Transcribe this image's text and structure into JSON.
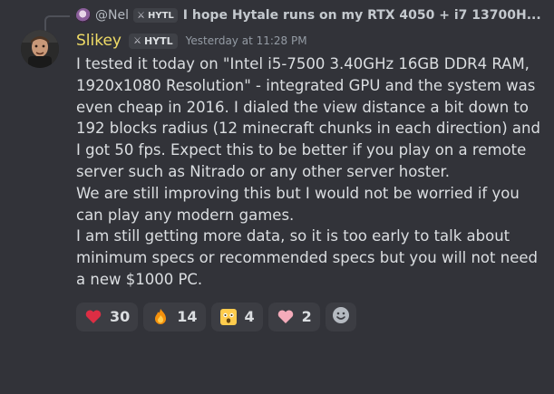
{
  "reply": {
    "avatar_icon": "reply-avatar-icon",
    "username": "@Nel",
    "tag": "HYTL",
    "text": "I hope Hytale runs on my RTX 4050 + i7 13700H..."
  },
  "message": {
    "avatar_icon": "user-avatar-icon",
    "username": "Slikey",
    "tag": "HYTL",
    "timestamp": "Yesterday at 11:28 PM",
    "paragraphs": [
      "I tested it today on \"Intel i5-7500 3.40GHz 16GB DDR4 RAM, 1920x1080 Resolution\" - integrated GPU and the system was even cheap in 2016. I dialed the view distance a bit down to 192 blocks radius (12 minecraft chunks in each direction) and I got 50 fps. Expect this to be better if you play on a remote server such as Nitrado or any other server hoster.",
      "We are still improving this but I would not be worried if you can play any modern games.",
      "I am still getting more data, so it is too early to talk about minimum specs or recommended specs but you will not need a new $1000 PC."
    ]
  },
  "reactions": [
    {
      "icon": "red-heart-emoji",
      "count": "30"
    },
    {
      "icon": "fire-emoji",
      "count": "14"
    },
    {
      "icon": "shocked-face-emoji",
      "count": "4"
    },
    {
      "icon": "pink-heart-emoji",
      "count": "2"
    }
  ],
  "add_reaction_icon": "add-reaction-icon",
  "colors": {
    "background": "#323339",
    "username": "#f0dc67",
    "text": "#dbdee1",
    "muted": "#949ba4"
  }
}
